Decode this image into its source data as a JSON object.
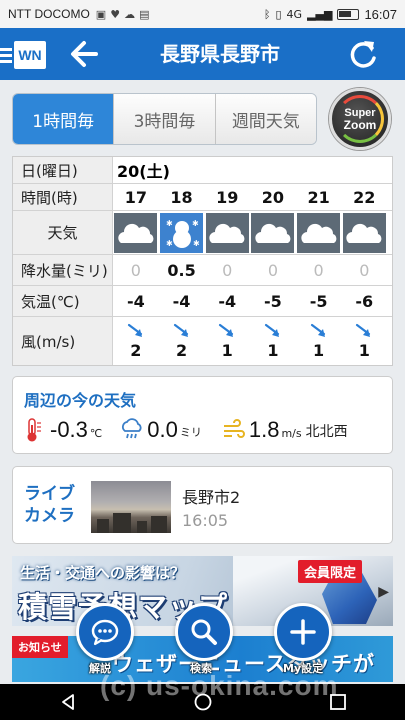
{
  "status": {
    "carrier": "NTT DOCOMO",
    "battery": "4G",
    "time": "16:07"
  },
  "header": {
    "logo": "WN",
    "title": "長野県長野市",
    "back_icon": "arrow-left-icon",
    "refresh_icon": "refresh-icon"
  },
  "tabs": [
    {
      "label": "1時間毎",
      "active": true
    },
    {
      "label": "3時間毎",
      "active": false
    },
    {
      "label": "週間天気",
      "active": false
    }
  ],
  "superzoom": {
    "line1": "Super",
    "line2": "Zoom"
  },
  "forecast": {
    "labels": {
      "date": "日(曜日)",
      "hour": "時間(時)",
      "weather": "天気",
      "precip": "降水量(ミリ)",
      "temp": "気温(℃)",
      "wind": "風(m/s)"
    },
    "date": "20(土)",
    "hours": [
      "17",
      "18",
      "19",
      "20",
      "21",
      "22"
    ],
    "weather": [
      "cloudy-icon",
      "snow-icon",
      "cloudy-icon",
      "cloudy-icon",
      "cloudy-icon",
      "cloudy-icon"
    ],
    "precip": [
      "0",
      "0.5",
      "0",
      "0",
      "0",
      "0"
    ],
    "temp": [
      "-4",
      "-4",
      "-4",
      "-5",
      "-5",
      "-6"
    ],
    "wind_speed": [
      "2",
      "2",
      "1",
      "1",
      "1",
      "1"
    ],
    "wind_direction": [
      "north-northwest",
      "north-northwest",
      "north-northwest",
      "north-northwest",
      "north-northwest",
      "north-northwest"
    ]
  },
  "nearby": {
    "title": "周辺の今の天気",
    "temp_value": "-0.3",
    "temp_unit": "℃",
    "precip_value": "0.0",
    "precip_unit": "ミリ",
    "wind_value": "1.8",
    "wind_unit": "m/s",
    "wind_dir": "北北西"
  },
  "camera": {
    "label_line1": "ライブ",
    "label_line2": "カメラ",
    "place": "長野市2",
    "time": "16:05"
  },
  "banner1": {
    "subtitle": "生活・交通への影響は？",
    "title": "積雪予想マップ",
    "badge": "会員限定"
  },
  "banner2": {
    "notice": "お知らせ",
    "text": "ウェザーニュースタッチが"
  },
  "fabs": [
    {
      "label": "解説",
      "icon": "chat-icon"
    },
    {
      "label": "検索",
      "icon": "search-icon"
    },
    {
      "label": "My設定",
      "icon": "plus-icon"
    }
  ],
  "watermark": "(c) us-okina.com",
  "colors": {
    "brand": "#1a6fc7",
    "tab_active": "#2e86d8",
    "cloudy_bg": "#5d6a76",
    "snow_bg": "#3d82cf",
    "accent_text": "#1e6fc1",
    "badge": "#e21d2b"
  }
}
